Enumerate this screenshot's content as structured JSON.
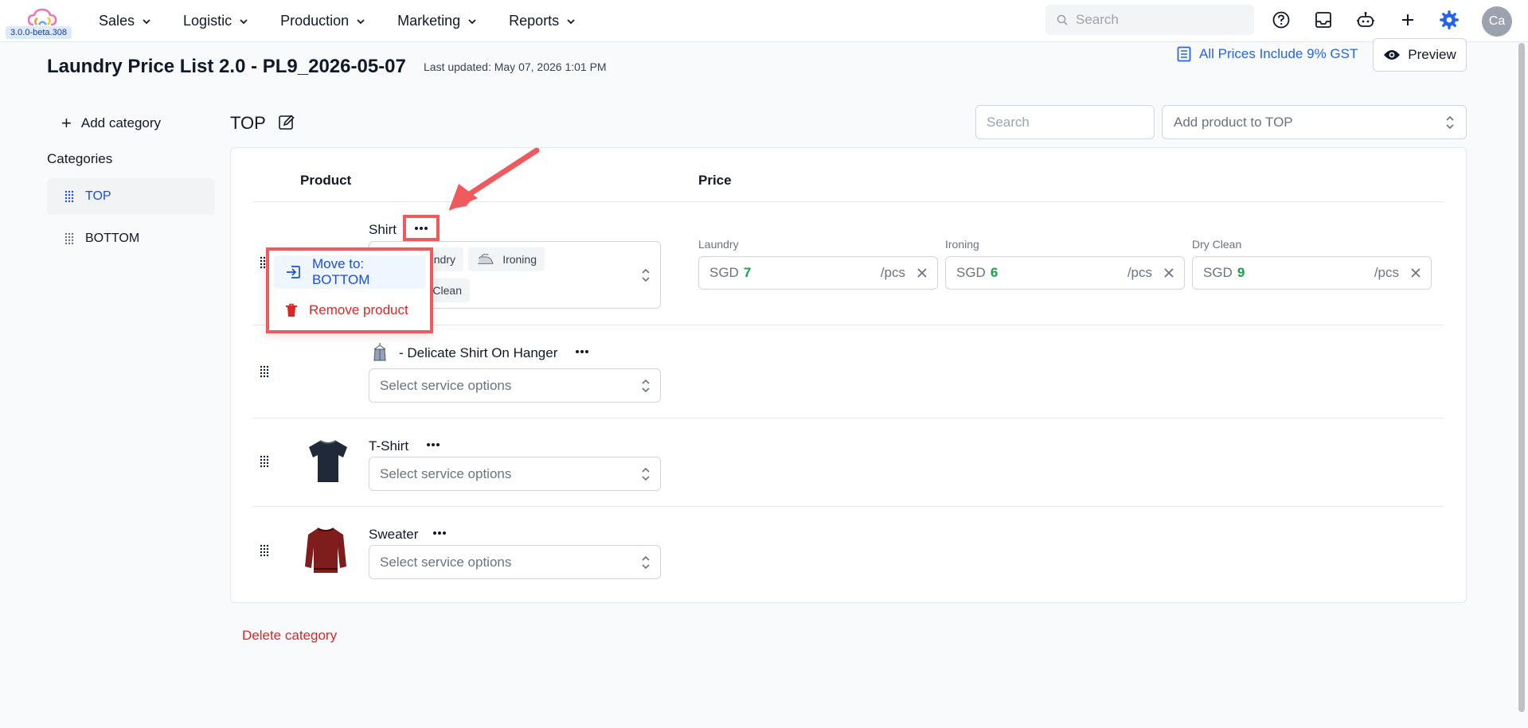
{
  "app": {
    "version": "3.0.0-beta.308",
    "nav": [
      {
        "label": "Sales"
      },
      {
        "label": "Logistic"
      },
      {
        "label": "Production"
      },
      {
        "label": "Marketing"
      },
      {
        "label": "Reports"
      }
    ],
    "search_placeholder": "Search",
    "avatar_initials": "Ca",
    "accent": "#2563eb"
  },
  "header": {
    "title": "Laundry Price List 2.0 - PL9_2026-05-07",
    "last_updated": "Last updated: May 07, 2026 1:01 PM",
    "gst_note": "All Prices Include 9% GST",
    "preview_label": "Preview"
  },
  "sidebar": {
    "add_category_label": "Add category",
    "heading": "Categories",
    "categories": [
      {
        "label": "TOP",
        "active": true
      },
      {
        "label": "BOTTOM",
        "active": false
      }
    ]
  },
  "category": {
    "title": "TOP",
    "search_placeholder": "Search",
    "add_product_placeholder": "Add product to TOP",
    "columns": {
      "product": "Product",
      "price": "Price"
    },
    "delete_label": "Delete category"
  },
  "products": [
    {
      "name": "Shirt",
      "tags": [
        "Laundry",
        "Ironing",
        "Dry Clean"
      ],
      "tags_visible_text": [
        "ndry",
        "Ironing",
        "Clean"
      ],
      "prices": [
        {
          "label": "Laundry",
          "currency": "SGD",
          "amount": "7",
          "unit": "/pcs"
        },
        {
          "label": "Ironing",
          "currency": "SGD",
          "amount": "6",
          "unit": "/pcs"
        },
        {
          "label": "Dry Clean",
          "currency": "SGD",
          "amount": "9",
          "unit": "/pcs"
        }
      ]
    },
    {
      "name": "- Delicate Shirt On Hanger",
      "placeholder": "Select service options"
    },
    {
      "name": "T-Shirt",
      "placeholder": "Select service options"
    },
    {
      "name": "Sweater",
      "placeholder": "Select service options"
    }
  ],
  "context_menu": {
    "move_label": "Move to: BOTTOM",
    "remove_label": "Remove product"
  }
}
